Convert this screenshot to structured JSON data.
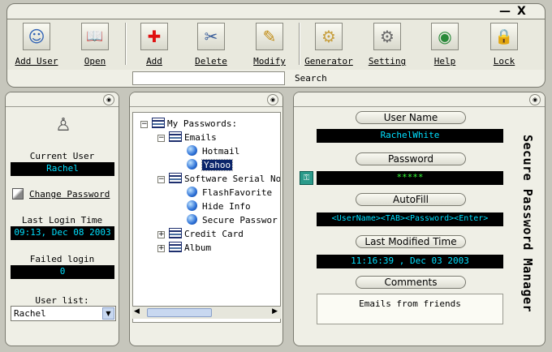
{
  "window": {
    "minimize_symbol": "—",
    "close_symbol": "X"
  },
  "toolbar": {
    "buttons": [
      {
        "label": "Add User",
        "icon": "add-user-icon",
        "glyph": "☺"
      },
      {
        "label": "Open",
        "icon": "open-book-icon",
        "glyph": "📖"
      },
      {
        "label": "Add",
        "icon": "add-cross-icon",
        "glyph": "✚"
      },
      {
        "label": "Delete",
        "icon": "delete-scissors-icon",
        "glyph": "✂"
      },
      {
        "label": "Modify",
        "icon": "modify-pencil-icon",
        "glyph": "✎"
      },
      {
        "label": "Generator",
        "icon": "generator-icon",
        "glyph": "⚙"
      },
      {
        "label": "Setting",
        "icon": "setting-gear-icon",
        "glyph": "⚙"
      },
      {
        "label": "Help",
        "icon": "help-globe-icon",
        "glyph": "◉"
      },
      {
        "label": "Lock",
        "icon": "lock-icon",
        "glyph": "🔒"
      }
    ]
  },
  "search": {
    "label": "Search",
    "value": ""
  },
  "left_panel": {
    "current_user_label": "Current User",
    "current_user": "Rachel",
    "change_password": "Change Password",
    "last_login_label": "Last Login Time",
    "last_login": "09:13, Dec 08 2003",
    "failed_login_label": "Failed login",
    "failed_login": "0",
    "user_list_label": "User list:",
    "user_list_selected": "Rachel"
  },
  "tree": {
    "root": "My Passwords:",
    "emails": "Emails",
    "hotmail": "Hotmail",
    "yahoo": "Yahoo",
    "software": "Software Serial No",
    "flashfavorite": "FlashFavorite",
    "hide_info": "Hide Info",
    "secure_password": "Secure Passwor",
    "credit_card": "Credit Card",
    "album": "Album"
  },
  "details": {
    "username_label": "User Name",
    "username": "RachelWhite",
    "password_label": "Password",
    "password": "*****",
    "autofill_label": "AutoFill",
    "autofill": "<UserName><TAB><Password><Enter>",
    "modified_label": "Last Modified Time",
    "modified": "11:16:39 , Dec 03 2003",
    "comments_label": "Comments",
    "comments": "Emails from friends"
  },
  "app_title": "Secure Password Manager",
  "colors": {
    "lcd_text": "#00e0ff",
    "lcd_green": "#39ff39",
    "lcd_bg": "#000000",
    "panel": "#efefe6"
  }
}
